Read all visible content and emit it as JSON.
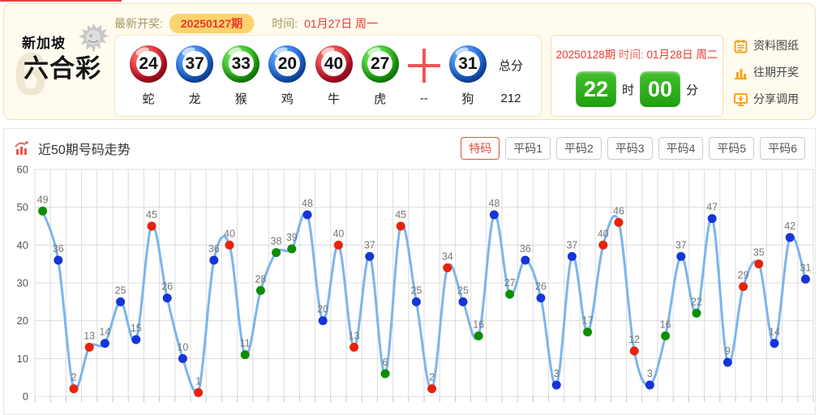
{
  "header": {
    "logo": {
      "line1": "新加坡",
      "line2": "六合彩",
      "watermark": "6"
    },
    "latest_label": "最新开奖:",
    "period_badge": "20250127期",
    "time_label": "时间:",
    "time_value": "01月27日 周一",
    "balls": [
      {
        "num": "24",
        "color": "red",
        "zodiac": "蛇"
      },
      {
        "num": "37",
        "color": "blue",
        "zodiac": "龙"
      },
      {
        "num": "33",
        "color": "green",
        "zodiac": "猴"
      },
      {
        "num": "20",
        "color": "blue",
        "zodiac": "鸡"
      },
      {
        "num": "40",
        "color": "red",
        "zodiac": "牛"
      },
      {
        "num": "27",
        "color": "green",
        "zodiac": "虎"
      },
      {
        "num": "31",
        "color": "blue",
        "zodiac": "狗"
      }
    ],
    "plus_zodiac": "--",
    "total_label": "总分",
    "total_value": "212",
    "next": {
      "period": "20250128期",
      "time_label": "时间:",
      "date": "01月28日 周二",
      "hour": "22",
      "hour_unit": "时",
      "minute": "00",
      "minute_unit": "分"
    },
    "links": [
      {
        "icon": "notes-icon",
        "label": "资料图纸"
      },
      {
        "icon": "chart-bar-icon",
        "label": "往期开奖"
      },
      {
        "icon": "share-icon",
        "label": "分享调用"
      }
    ]
  },
  "trend": {
    "title": "近50期号码走势",
    "tabs": [
      {
        "label": "特码",
        "active": true
      },
      {
        "label": "平码1"
      },
      {
        "label": "平码2"
      },
      {
        "label": "平码3"
      },
      {
        "label": "平码4"
      },
      {
        "label": "平码5"
      },
      {
        "label": "平码6"
      }
    ]
  },
  "chart_data": {
    "type": "line",
    "title": "近50期号码走势",
    "xlabel": "",
    "ylabel": "",
    "ylim": [
      0,
      60
    ],
    "yticks": [
      0,
      10,
      20,
      30,
      40,
      50,
      60
    ],
    "grid": true,
    "legend": "none",
    "line_color": "#7cb5ec",
    "grid_color": "#dcdcdc",
    "tick_color": "#a9cbec",
    "label_color": "#777777",
    "axis_label_color": "#555555",
    "point_colors": {
      "red": "#e8220d",
      "blue": "#1734d8",
      "green": "#0d8e00"
    },
    "values": [
      49,
      36,
      2,
      13,
      14,
      25,
      15,
      45,
      26,
      10,
      1,
      36,
      40,
      11,
      28,
      38,
      39,
      48,
      20,
      40,
      13,
      37,
      6,
      45,
      25,
      2,
      34,
      25,
      16,
      48,
      27,
      36,
      26,
      3,
      37,
      17,
      40,
      46,
      12,
      3,
      16,
      37,
      22,
      47,
      9,
      29,
      35,
      14,
      42,
      31
    ],
    "colors": [
      "green",
      "blue",
      "red",
      "red",
      "blue",
      "blue",
      "blue",
      "red",
      "blue",
      "blue",
      "red",
      "blue",
      "red",
      "green",
      "green",
      "green",
      "green",
      "blue",
      "blue",
      "red",
      "red",
      "blue",
      "green",
      "red",
      "blue",
      "red",
      "red",
      "blue",
      "green",
      "blue",
      "green",
      "blue",
      "blue",
      "blue",
      "blue",
      "green",
      "red",
      "red",
      "red",
      "blue",
      "green",
      "blue",
      "green",
      "blue",
      "blue",
      "red",
      "red",
      "blue",
      "blue",
      "blue"
    ]
  }
}
